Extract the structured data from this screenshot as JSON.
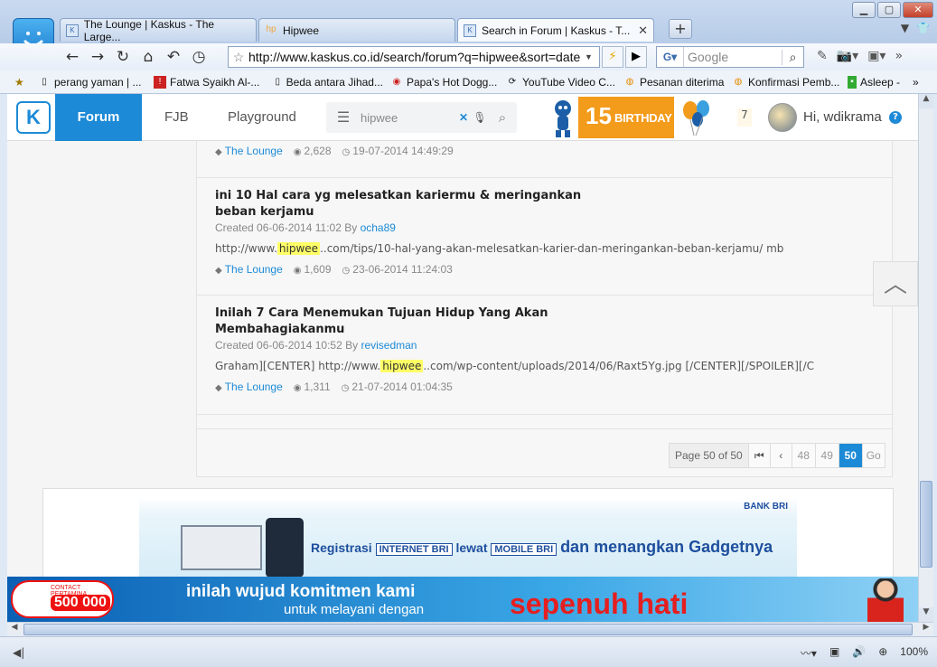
{
  "browser": {
    "tabs": [
      {
        "label": "The Lounge | Kaskus - The Large..."
      },
      {
        "label": "Hipwee"
      },
      {
        "label": "Search in Forum | Kaskus - T..."
      }
    ],
    "new_tab": "+",
    "url": "http://www.kaskus.co.id/search/forum?q=hipwee&sort=date",
    "search_placeholder": "Google",
    "bookmarks": [
      {
        "label": "perang yaman | ..."
      },
      {
        "label": "Fatwa Syaikh Al-..."
      },
      {
        "label": "Beda antara Jihad..."
      },
      {
        "label": "Papa's Hot Dogg..."
      },
      {
        "label": "YouTube Video C..."
      },
      {
        "label": "Pesanan diterima"
      },
      {
        "label": "Konfirmasi Pemb..."
      },
      {
        "label": "Asleep -"
      }
    ],
    "zoom": "100%"
  },
  "header": {
    "nav": [
      {
        "label": "Forum"
      },
      {
        "label": "FJB"
      },
      {
        "label": "Playground"
      }
    ],
    "search_value": "hipwee",
    "birthday_number": "15",
    "birthday_label": "BIRTHDAY",
    "notif_count": "7",
    "greeting": "Hi, wdikrama"
  },
  "results": [
    {
      "title": "",
      "created": "",
      "author": "",
      "snippet_pre": "",
      "snippet_hl": "",
      "snippet_post": "",
      "forum": "The Lounge",
      "views": "2,628",
      "last": "19-07-2014 14:49:29"
    },
    {
      "title": "ini 10 Hal cara yg melesatkan kariermu & meringankan beban kerjamu",
      "created": "Created 06-06-2014 11:02 By ",
      "author": "ocha89",
      "snippet_pre": "http://www.",
      "snippet_hl": "hipwee",
      "snippet_post": "..com/tips/10-hal-yang-akan-melesatkan-karier-dan-meringankan-beban-kerjamu/ mb",
      "forum": "The Lounge",
      "views": "1,609",
      "last": "23-06-2014 11:24:03"
    },
    {
      "title": "Inilah 7 Cara Menemukan Tujuan Hidup Yang Akan Membahagiakanmu",
      "created": "Created 06-06-2014 10:52 By ",
      "author": "revisedman",
      "snippet_pre": "Graham][CENTER] http://www.",
      "snippet_hl": "hipwee",
      "snippet_post": "..com/wp-content/uploads/2014/06/Raxt5Yg.jpg [/CENTER][/SPOILER][/C",
      "forum": "The Lounge",
      "views": "1,311",
      "last": "21-07-2014 01:04:35"
    }
  ],
  "pager": {
    "info": "Page 50 of 50",
    "first": "⏮",
    "prev": "‹",
    "pages": [
      "48",
      "49"
    ],
    "current": "50",
    "go": "Go"
  },
  "ads": {
    "bri_logo": "BANK BRI",
    "bri_text1": "Registrasi",
    "bri_box1": "INTERNET BRI",
    "bri_text2": "lewat",
    "bri_box2": "MOBILE BRI",
    "bri_text3": "dan menangkan Gadgetnya",
    "pertamina_contact": "CONTACT PERTAMINA",
    "pertamina_number": "500 000",
    "pertamina_line1": "inilah wujud komitmen kami",
    "pertamina_line2": "untuk melayani dengan",
    "pertamina_red": "sepenuh hati"
  }
}
